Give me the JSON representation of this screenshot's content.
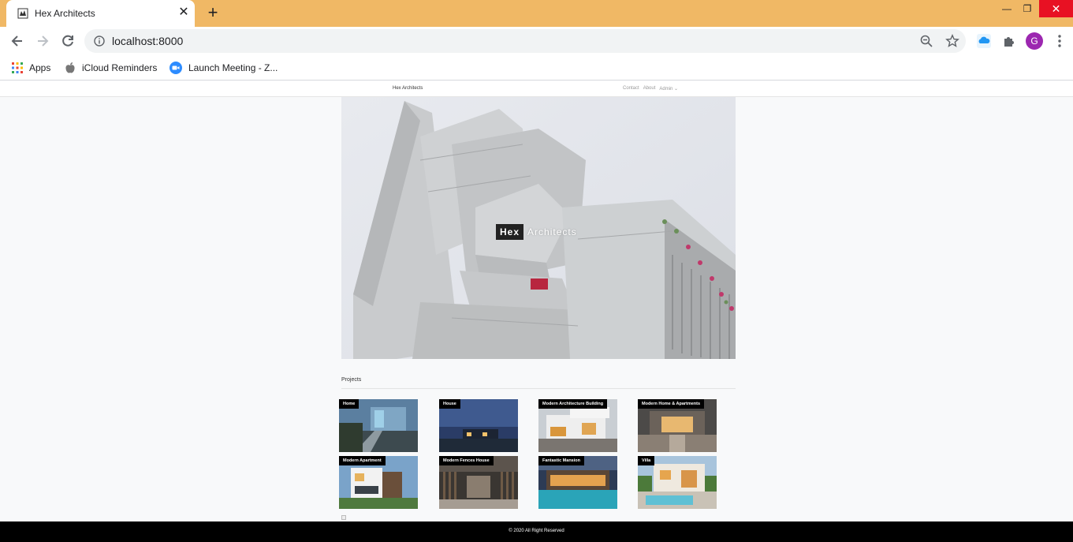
{
  "browser": {
    "tab_title": "Hex Architects",
    "tab_close": "✕",
    "new_tab": "+",
    "url": "localhost:8000",
    "avatar_initial": "G",
    "win_min": "—",
    "win_max": "❐",
    "win_close": "✕",
    "bookmarks": [
      {
        "label": "Apps",
        "icon": "apps-grid-icon"
      },
      {
        "label": "iCloud Reminders",
        "icon": "apple-icon"
      },
      {
        "label": "Launch Meeting - Z...",
        "icon": "zoom-video-icon"
      }
    ]
  },
  "site": {
    "brand": "Hex Architects",
    "nav": [
      "Contact",
      "About",
      "Admin ⌄"
    ],
    "hero": {
      "word1": "Hex",
      "word2": "Architects"
    },
    "projects_heading": "Projects",
    "projects": [
      {
        "label": "Home"
      },
      {
        "label": "House"
      },
      {
        "label": "Modern Architecture Building"
      },
      {
        "label": "Modern Home & Apartments"
      },
      {
        "label": "Modern Apartment"
      },
      {
        "label": "Modern Fences House"
      },
      {
        "label": "Fantastic Mansion"
      },
      {
        "label": "Villa"
      }
    ],
    "footer": "© 2020 All Right Reserved"
  },
  "colors": {
    "titlebar": "#f0b865",
    "close_button": "#e81123",
    "avatar": "#9c27b0",
    "footer": "#000000"
  }
}
